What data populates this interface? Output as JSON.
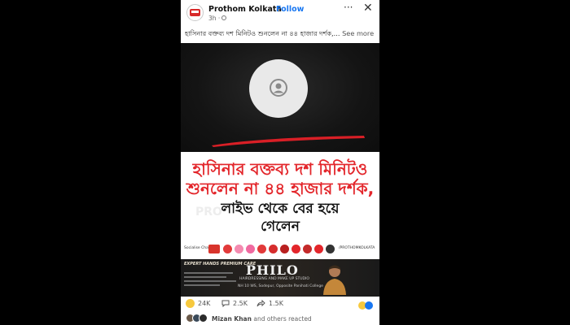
{
  "header": {
    "page_name": "Prothom Kolkata",
    "separator": "·",
    "follow_label": "Follow",
    "time": "3h ·",
    "more_label": "···",
    "close_label": "✕"
  },
  "post": {
    "caption": "হাসিনার বক্তব্য দশ মিনিটও শুনলেন না ৪৪ হাজার দর্শক,...",
    "see_more": "See more"
  },
  "image": {
    "headline_line1": "হাসিনার বক্তব্য দশ মিনিটও",
    "headline_line2": "শুনলেন না ৪৪ হাজার দর্শক,",
    "headline_line3": "লাইভ থেকে বের হয়ে",
    "headline_line4": "গেলেন",
    "watermark": "PRO",
    "social_label": "Socialise Channel",
    "social_handle": "/PROTHOMKOLKATA",
    "accent_red": "#e3262b"
  },
  "ad": {
    "tag": "EXPERT HANDS PREMIUM CARE",
    "brand": "PHILO",
    "subtitle": "HAIRDRESSING AND MAKE UP STUDIO",
    "address": "NH 10 WS, Sodepur, Opposite Panihati College"
  },
  "stats": {
    "reactions": "24K",
    "comments": "2.5K",
    "shares": "1.5K"
  },
  "reacted": {
    "name": "Mizan Khan",
    "suffix": "and others reacted"
  }
}
